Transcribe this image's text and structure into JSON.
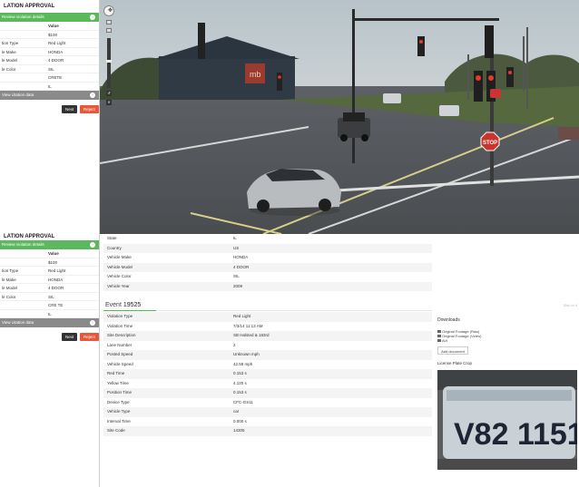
{
  "panel": {
    "title": "LATION APPROVAL",
    "review_label": "Review violation details",
    "col_header": "Value",
    "rows": [
      {
        "k": "",
        "v": "$100"
      },
      {
        "k": "tion Type",
        "v": "Red Light"
      },
      {
        "k": "le Make",
        "v": "HONDA"
      },
      {
        "k": "le Model",
        "v": "4 DOOR"
      },
      {
        "k": "le Color",
        "v": "SIL"
      },
      {
        "k": "",
        "v": "CRETE"
      },
      {
        "k": "",
        "v": "IL"
      }
    ],
    "other_label": "View citation data",
    "next": "Next",
    "reject": "Reject"
  },
  "panel2": {
    "title": "LATION APPROVAL",
    "review_label": "Review violation details",
    "col_header": "Value",
    "rows": [
      {
        "k": "",
        "v": "$100"
      },
      {
        "k": "tion Type",
        "v": "Red Light"
      },
      {
        "k": "le Make",
        "v": "HONDA"
      },
      {
        "k": "le Model",
        "v": "4 DOOR"
      },
      {
        "k": "le Color",
        "v": "SIL"
      },
      {
        "k": "",
        "v": "CRE TE"
      },
      {
        "k": "",
        "v": "IL"
      }
    ],
    "other_label": "View citation data",
    "next": "Next",
    "reject": "Reject"
  },
  "camera": {
    "stop_text": "STOP",
    "sign_text": "mb"
  },
  "vehicle": {
    "rows": [
      {
        "k": "State",
        "v": "IL"
      },
      {
        "k": "Country",
        "v": "US"
      },
      {
        "k": "Vehicle Make",
        "v": "HONDA"
      },
      {
        "k": "Vehicle Model",
        "v": "4 DOOR"
      },
      {
        "k": "Vehicle Color",
        "v": "SIL"
      },
      {
        "k": "Vehicle Year",
        "v": "2009"
      }
    ]
  },
  "event": {
    "label": "Event",
    "number": "19525",
    "ref": "Skip to it",
    "rows": [
      {
        "k": "Violation Type",
        "v": "Red Light"
      },
      {
        "k": "Violation Time",
        "v": "7/3/14 11:13 AM"
      },
      {
        "k": "Site Description",
        "v": "SB Halsted & 183rd"
      },
      {
        "k": "Lane Number",
        "v": "2"
      },
      {
        "k": "Posted Speed",
        "v": "Unknown mph"
      },
      {
        "k": "Vehicle Speed",
        "v": "42.58 mph"
      },
      {
        "k": "Red Time",
        "v": "0.153 s"
      },
      {
        "k": "Yellow Time",
        "v": "4.120 s"
      },
      {
        "k": "Position Time",
        "v": "0.153 s"
      },
      {
        "k": "Device Type",
        "v": "CFC-GS11"
      },
      {
        "k": "Vehicle Type",
        "v": "car"
      },
      {
        "k": "Interval Time",
        "v": "0.000 s"
      },
      {
        "k": "Site Code",
        "v": "14305"
      }
    ]
  },
  "downloads": {
    "title": "Downloads",
    "items": [
      "Original Footage (Raw)",
      "Original Footage (Video)",
      "AVI"
    ],
    "add": "Add document",
    "plate_title": "License Plate Crop",
    "plate_text": "V82 1151"
  }
}
